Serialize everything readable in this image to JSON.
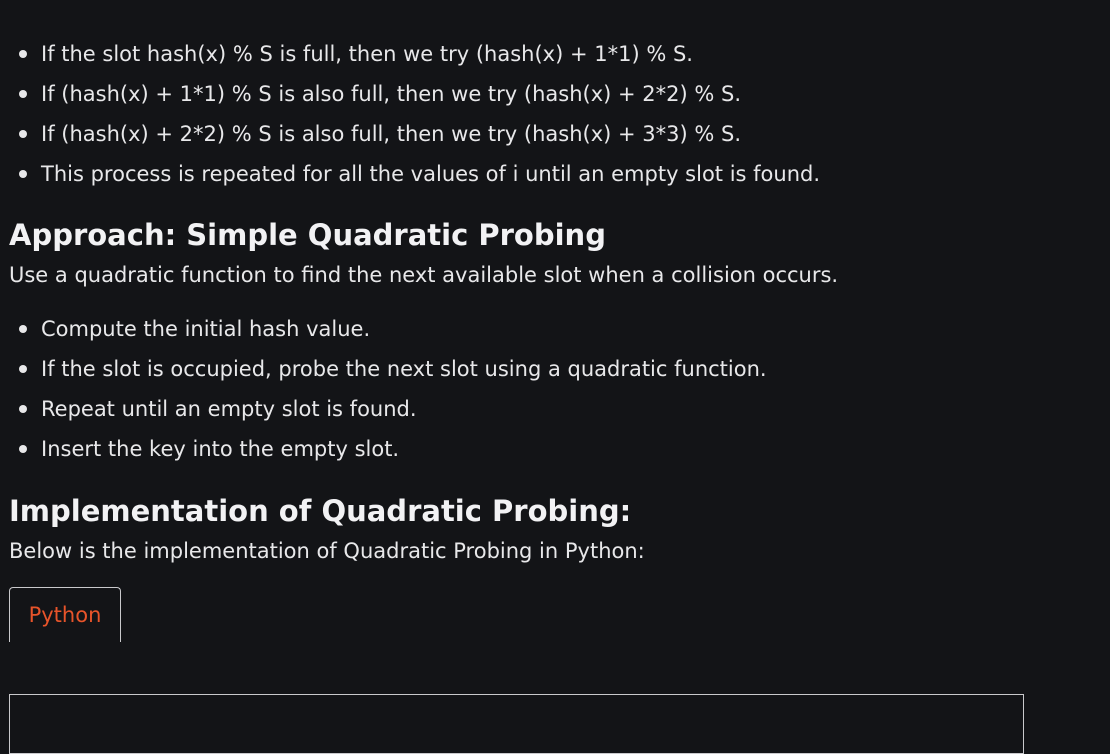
{
  "intro_list": [
    "If the slot hash(x) % S is full, then we try (hash(x) + 1*1) % S.",
    "If (hash(x) + 1*1) % S is also full, then we try (hash(x) + 2*2) % S.",
    "If (hash(x) + 2*2) % S is also full, then we try (hash(x) + 3*3) % S.",
    "This process is repeated for all the values of i until an empty slot is found."
  ],
  "approach": {
    "heading": "Approach: Simple Quadratic Probing",
    "lead": "Use a quadratic function to find the next available slot when a collision occurs.",
    "steps": [
      "Compute the initial hash value.",
      "If the slot is occupied, probe the next slot using a quadratic function.",
      "Repeat until an empty slot is found.",
      "Insert the key into the empty slot."
    ]
  },
  "implementation": {
    "heading": "Implementation of Quadratic Probing:",
    "lead": "Below is the implementation of Quadratic Probing in Python:"
  },
  "code_tabs": {
    "active_tab": "Python",
    "active_color": "#e8542a"
  }
}
